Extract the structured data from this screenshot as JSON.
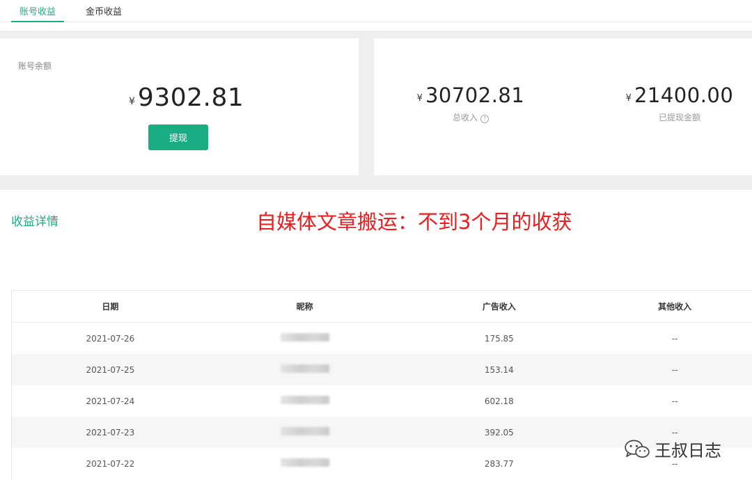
{
  "tabs": [
    {
      "label": "账号收益",
      "active": true
    },
    {
      "label": "金币收益",
      "active": false
    }
  ],
  "balance": {
    "label": "账号余额",
    "currency": "¥",
    "amount": "9302.81",
    "withdraw_button": "提现"
  },
  "stats": {
    "total_income": {
      "currency": "¥",
      "amount": "30702.81",
      "label": "总收入"
    },
    "withdrawn": {
      "currency": "¥",
      "amount": "21400.00",
      "label": "已提现金额"
    }
  },
  "details": {
    "title": "收益详情",
    "caption": "自媒体文章搬运：不到3个月的收获"
  },
  "table": {
    "headers": [
      "日期",
      "昵称",
      "广告收入",
      "其他收入"
    ],
    "rows": [
      {
        "date": "2021-07-26",
        "ad": "175.85",
        "other": "--"
      },
      {
        "date": "2021-07-25",
        "ad": "153.14",
        "other": "--"
      },
      {
        "date": "2021-07-24",
        "ad": "602.18",
        "other": "--"
      },
      {
        "date": "2021-07-23",
        "ad": "392.05",
        "other": "--"
      },
      {
        "date": "2021-07-22",
        "ad": "283.77",
        "other": "--"
      }
    ]
  },
  "watermark": {
    "text": "王叔日志",
    "icon": "wechat-icon"
  },
  "colors": {
    "accent": "#1aad83",
    "caption": "#ee1c1c"
  }
}
